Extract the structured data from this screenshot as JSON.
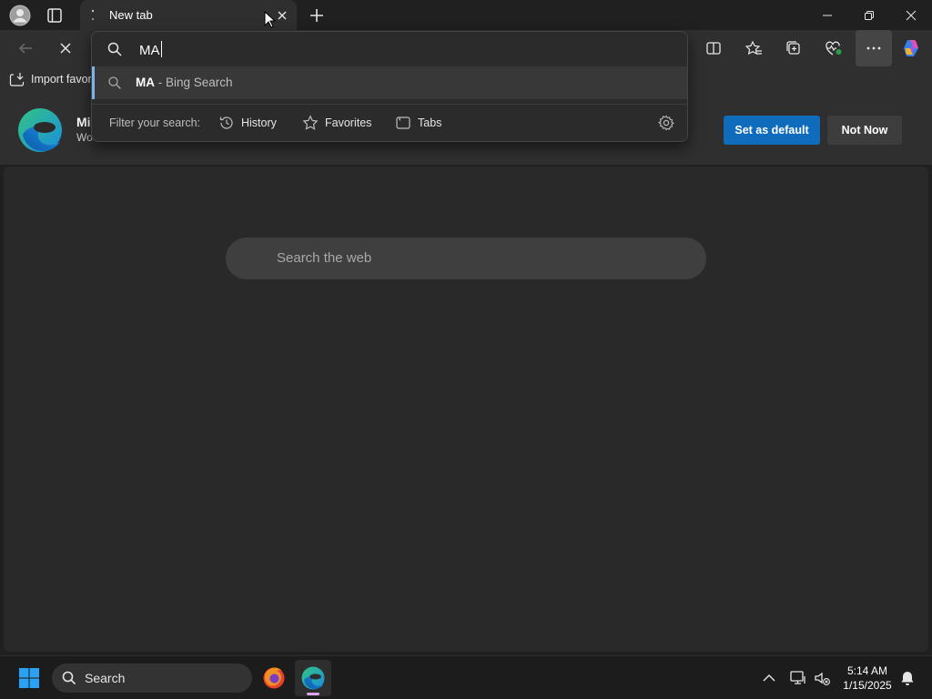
{
  "window": {
    "tab_title": "New tab"
  },
  "address_bar": {
    "typed_text": "MA",
    "suggestion": {
      "strong": "MA",
      "rest": " - Bing Search"
    },
    "filter_label": "Filter your search:",
    "filters": [
      {
        "label": "History",
        "icon": "history-icon"
      },
      {
        "label": "Favorites",
        "icon": "star-icon"
      },
      {
        "label": "Tabs",
        "icon": "tabs-icon"
      }
    ]
  },
  "favorites_bar": {
    "import_label": "Import favor"
  },
  "banner": {
    "title": "Mi",
    "subtitle": "Wo",
    "primary_button": "Set as default",
    "secondary_button": "Not Now"
  },
  "new_tab": {
    "search_placeholder": "Search the web"
  },
  "taskbar": {
    "search_label": "Search",
    "time": "5:14 AM",
    "date": "1/15/2025"
  },
  "colors": {
    "accent": "#0f6cbd",
    "suggestion_accent": "#7ab4ea",
    "background": "#202020",
    "content": "#292929"
  }
}
